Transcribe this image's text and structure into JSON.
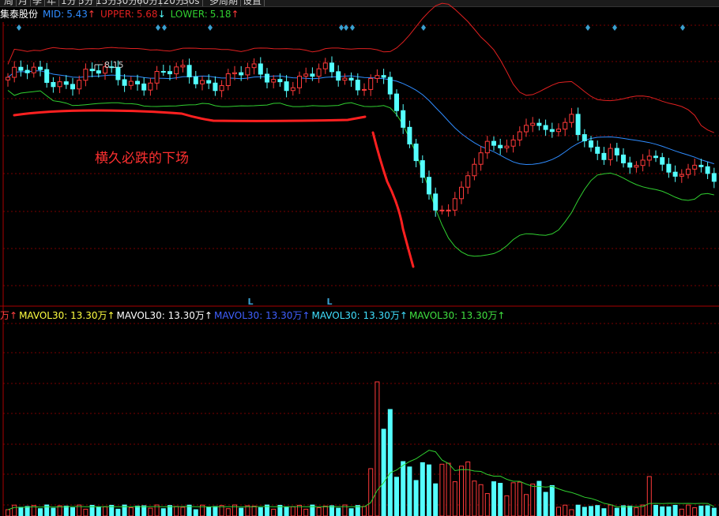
{
  "toolbar": {
    "buttons": [
      "周",
      "月",
      "季",
      "年",
      "1分",
      "5分",
      "15分",
      "30分",
      "60分",
      "120分",
      "30s",
      "多周期",
      "设置"
    ]
  },
  "main_legend": {
    "name": "集泰股份",
    "mid_label": "MID:",
    "mid_value": "5.43",
    "mid_arrow": "↑",
    "upper_label": "UPPER:",
    "upper_value": "5.68",
    "upper_arrow": "↓",
    "lower_label": "LOWER:",
    "lower_value": "5.18",
    "lower_arrow": "↑"
  },
  "volume_legend": {
    "items": [
      {
        "text": "万↑",
        "color": "#ff4040"
      },
      {
        "text": "MAVOL30: 13.30万↑",
        "color": "#ffff40"
      },
      {
        "text": "MAVOL30: 13.30万↑",
        "color": "#ffffff"
      },
      {
        "text": "MAVOL30: 13.30万↑",
        "color": "#4060ff"
      },
      {
        "text": "MAVOL30: 13.30万↑",
        "color": "#40e0ff"
      },
      {
        "text": "MAVOL30: 13.30万↑",
        "color": "#40e040"
      }
    ]
  },
  "annotation": "横久必跌的下场",
  "high_marker": "8.15",
  "signal_marker": "L",
  "colors": {
    "up": "#ff3a3a",
    "down": "#54ffff",
    "mid": "#2f8cff",
    "upper": "#e02020",
    "lower": "#30d030",
    "grid": "#7a0000",
    "diamond": "#3aa0d0"
  },
  "chart_data": {
    "type": "candlestick",
    "symbol": "集泰股份",
    "indicators": {
      "BOLL": {
        "MID": 5.43,
        "UPPER": 5.68,
        "LOWER": 5.18
      },
      "MAVOL30": "13.30万"
    },
    "annotations": [
      "8.15",
      "横久必跌的下场",
      "L",
      "L"
    ]
  }
}
